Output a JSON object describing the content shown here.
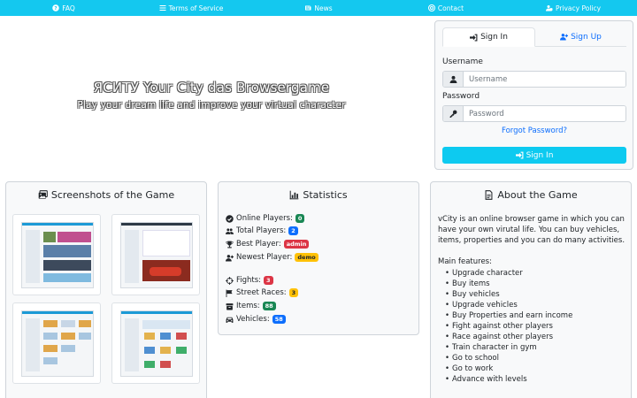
{
  "nav": {
    "items": [
      {
        "label": "FAQ",
        "icon": "question-circle-icon"
      },
      {
        "label": "Terms of Service",
        "icon": "list-icon"
      },
      {
        "label": "News",
        "icon": "newspaper-icon"
      },
      {
        "label": "Contact",
        "icon": "support-icon"
      },
      {
        "label": "Privacy Policy",
        "icon": "user-shield-icon"
      }
    ],
    "color": "#14c8ef"
  },
  "hero": {
    "title": "ЯCИTУ Your City das Browsergame",
    "subtitle": "Play your dream life and improve your virtual character"
  },
  "login": {
    "tab_signin": "Sign In",
    "tab_signup": "Sign Up",
    "username_label": "Username",
    "username_placeholder": "Username",
    "password_label": "Password",
    "password_placeholder": "Password",
    "forgot": "Forgot Password?",
    "submit": "Sign In",
    "button_color": "#0dcaf0"
  },
  "screenshots": {
    "title": "Screenshots of the Game",
    "count": 4
  },
  "stats": {
    "title": "Statistics",
    "rows": [
      {
        "label": "Online Players:",
        "value": "0",
        "color": "#198754",
        "icon": "check-circle-icon"
      },
      {
        "label": "Total Players:",
        "value": "2",
        "color": "#0d6efd",
        "icon": "users-icon"
      },
      {
        "label": "Best Player:",
        "value": "admin",
        "color": "#dc3545",
        "icon": "trophy-icon"
      },
      {
        "label": "Newest Player:",
        "value": "demo",
        "color": "#ffc107",
        "icon": "user-plus-icon"
      },
      {
        "label": "Fights:",
        "value": "3",
        "color": "#dc3545",
        "icon": "crosshairs-icon"
      },
      {
        "label": "Street Races:",
        "value": "3",
        "color": "#ffc107",
        "icon": "flag-icon"
      },
      {
        "label": "Items:",
        "value": "88",
        "color": "#198754",
        "icon": "box-icon"
      },
      {
        "label": "Vehicles:",
        "value": "58",
        "color": "#0d6efd",
        "icon": "car-icon"
      }
    ]
  },
  "about": {
    "title": "About the Game",
    "text": "vCity is an online browser game in which you can have your own virutal life. You can buy vehicles, items, properties and you can do many activities.",
    "features_title": "Main features:",
    "features": [
      "Upgrade character",
      "Buy items",
      "Buy vehicles",
      "Upgrade vehicles",
      "Buy Properties and earn income",
      "Fight against other players",
      "Race against other players",
      "Train character in gym",
      "Go to school",
      "Go to work",
      "Advance with levels"
    ]
  }
}
